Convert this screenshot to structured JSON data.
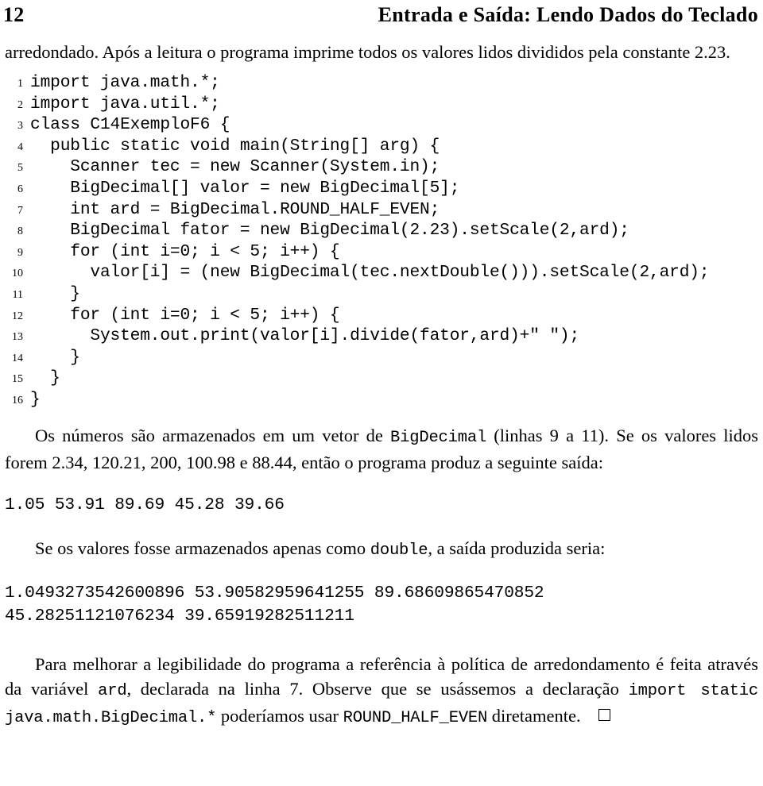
{
  "header": {
    "page_number": "12",
    "title": "Entrada e Saída: Lendo Dados do Teclado"
  },
  "intro_paragraph": {
    "text": "arredondado. Após a leitura o programa imprime todos os valores lidos divididos pela constante 2.23."
  },
  "listing": {
    "lines": [
      {
        "n": "1",
        "code": "import java.math.*;"
      },
      {
        "n": "2",
        "code": "import java.util.*;"
      },
      {
        "n": "3",
        "code": "class C14ExemploF6 {"
      },
      {
        "n": "4",
        "code": "  public static void main(String[] arg) {"
      },
      {
        "n": "5",
        "code": "    Scanner tec = new Scanner(System.in);"
      },
      {
        "n": "6",
        "code": "    BigDecimal[] valor = new BigDecimal[5];"
      },
      {
        "n": "7",
        "code": "    int ard = BigDecimal.ROUND_HALF_EVEN;"
      },
      {
        "n": "8",
        "code": "    BigDecimal fator = new BigDecimal(2.23).setScale(2,ard);"
      },
      {
        "n": "9",
        "code": "    for (int i=0; i < 5; i++) {"
      },
      {
        "n": "10",
        "code": "      valor[i] = (new BigDecimal(tec.nextDouble())).setScale(2,ard);"
      },
      {
        "n": "11",
        "code": "    }"
      },
      {
        "n": "12",
        "code": "    for (int i=0; i < 5; i++) {"
      },
      {
        "n": "13",
        "code": "      System.out.print(valor[i].divide(fator,ard)+\" \");"
      },
      {
        "n": "14",
        "code": "    }"
      },
      {
        "n": "15",
        "code": "  }"
      },
      {
        "n": "16",
        "code": "}"
      }
    ]
  },
  "paragraph_vetor": {
    "part1": "Os números são armazenados em um vetor de ",
    "code1": "BigDecimal",
    "part2": " (linhas 9 a 11). Se os valores lidos forem 2.34, 120.21, 200, 100.98 e 88.44, então o programa produz a seguinte saída:"
  },
  "output_bigdecimal": {
    "line1": "1.05 53.91 89.69 45.28 39.66"
  },
  "paragraph_double": {
    "part1": "Se os valores fosse armazenados apenas como ",
    "code1": "double",
    "part2": ", a saída produzida seria:"
  },
  "output_double": {
    "line1": "1.0493273542600896 53.90582959641255 89.68609865470852",
    "line2": "45.28251121076234 39.65919282511211"
  },
  "paragraph_final": {
    "part1": "Para melhorar a legibilidade do programa a referência à política de arredondamento é feita através da variável ",
    "code1": "ard",
    "part2": ", declarada na linha 7. Observe que se usássemos a declaração ",
    "code2": "import static java.math.BigDecimal.*",
    "part3": " poderíamos usar ",
    "code3": "ROUND_HALF_EVEN",
    "part4": " diretamente.",
    "qed_symbol": "□"
  }
}
